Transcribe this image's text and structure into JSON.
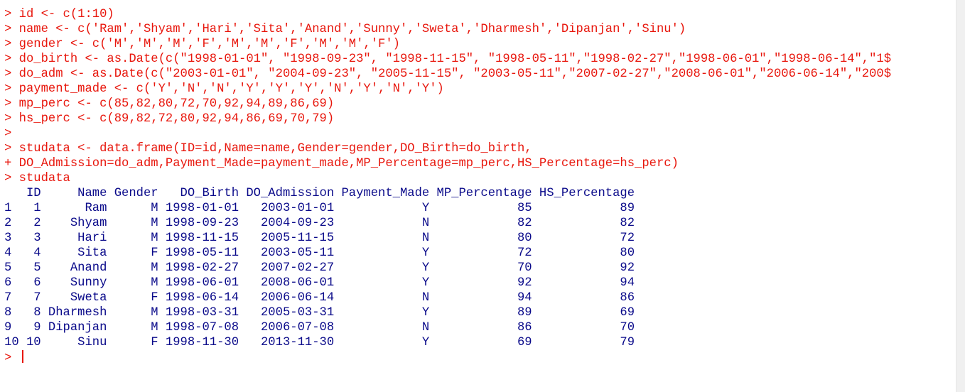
{
  "console": {
    "prompt_symbol": "> ",
    "commands": [
      "> id <- c(1:10)",
      "> name <- c('Ram','Shyam','Hari','Sita','Anand','Sunny','Sweta','Dharmesh','Dipanjan','Sinu')",
      "> gender <- c('M','M','M','F','M','M','F','M','M','F')",
      "> do_birth <- as.Date(c(\"1998-01-01\", \"1998-09-23\", \"1998-11-15\", \"1998-05-11\",\"1998-02-27\",\"1998-06-01\",\"1998-06-14\",\"1$",
      "> do_adm <- as.Date(c(\"2003-01-01\", \"2004-09-23\", \"2005-11-15\", \"2003-05-11\",\"2007-02-27\",\"2008-06-01\",\"2006-06-14\",\"200$",
      "> payment_made <- c('Y','N','N','Y','Y','Y','N','Y','N','Y')",
      "> mp_perc <- c(85,82,80,72,70,92,94,89,86,69)",
      "> hs_perc <- c(89,82,72,80,92,94,86,69,70,79)",
      ">",
      "> studata <- data.frame(ID=id,Name=name,Gender=gender,DO_Birth=do_birth,",
      "+ DO_Admission=do_adm,Payment_Made=payment_made,MP_Percentage=mp_perc,HS_Percentage=hs_perc)",
      "> studata"
    ],
    "output_lines": [
      "   ID     Name Gender   DO_Birth DO_Admission Payment_Made MP_Percentage HS_Percentage",
      "1   1      Ram      M 1998-01-01   2003-01-01            Y            85            89",
      "2   2    Shyam      M 1998-09-23   2004-09-23            N            82            82",
      "3   3     Hari      M 1998-11-15   2005-11-15            N            80            72",
      "4   4     Sita      F 1998-05-11   2003-05-11            Y            72            80",
      "5   5    Anand      M 1998-02-27   2007-02-27            Y            70            92",
      "6   6    Sunny      M 1998-06-01   2008-06-01            Y            92            94",
      "7   7    Sweta      F 1998-06-14   2006-06-14            N            94            86",
      "8   8 Dharmesh      M 1998-03-31   2005-03-31            Y            89            69",
      "9   9 Dipanjan      M 1998-07-08   2006-07-08            N            86            70",
      "10 10     Sinu      F 1998-11-30   2013-11-30            Y            69            79"
    ]
  },
  "colors": {
    "command_text": "#e8170d",
    "output_text": "#0a0a8a",
    "background": "#ffffff"
  }
}
